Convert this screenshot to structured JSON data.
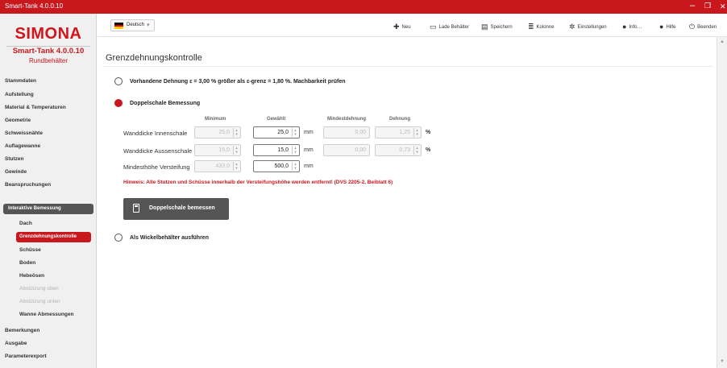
{
  "window": {
    "title": "Smart-Tank 4.0.0.10",
    "controls": {
      "minimize": "–",
      "restore": "❐",
      "close": "✕"
    }
  },
  "sidebar": {
    "logo": "SIMONA",
    "app_version": "Smart-Tank 4.0.0.10",
    "subtitle": "Rundbehälter",
    "items": [
      {
        "label": "Stammdaten"
      },
      {
        "label": "Aufstellung"
      },
      {
        "label": "Material & Temperaturen"
      },
      {
        "label": "Geometrie"
      },
      {
        "label": "Schweissnähte"
      },
      {
        "label": "Auflagewanne"
      },
      {
        "label": "Stutzen"
      },
      {
        "label": "Gewinde"
      },
      {
        "label": "Beanspruchungen"
      },
      {
        "label": "Interaktive Bemessung"
      },
      {
        "label": "Dach"
      },
      {
        "label": "Grenzdehnungskontrolle"
      },
      {
        "label": "Schüsse"
      },
      {
        "label": "Boden"
      },
      {
        "label": "Hebeösen"
      },
      {
        "label": "Abstützung oben"
      },
      {
        "label": "Abstützung unten"
      },
      {
        "label": "Wanne Abmessungen"
      },
      {
        "label": "Bemerkungen"
      },
      {
        "label": "Ausgabe"
      },
      {
        "label": "Parameterexport"
      }
    ]
  },
  "toolbar": {
    "language": "Deutsch",
    "buttons": [
      {
        "label": "Neu",
        "icon": "plus-icon"
      },
      {
        "label": "Lade Behälter",
        "icon": "folder-icon"
      },
      {
        "label": "Speichern",
        "icon": "save-icon"
      },
      {
        "label": "Kolonne",
        "icon": "column-icon"
      },
      {
        "label": "Einstellungen",
        "icon": "gear-icon"
      },
      {
        "label": "Info…",
        "icon": "info-icon"
      },
      {
        "label": "Hilfe",
        "icon": "help-icon"
      },
      {
        "label": "Beenden",
        "icon": "power-icon"
      }
    ]
  },
  "main": {
    "title": "Grenzdehnungskontrolle",
    "options": [
      {
        "label": "Vorhandene Dehnung ε = 3,00 % größer als ε-grenz = 1,80 %. Machbarkeit prüfen",
        "selected": false
      },
      {
        "label": "Doppelschale Bemessung",
        "selected": true
      },
      {
        "label": "Als Wickelbehälter ausführen",
        "selected": false
      }
    ],
    "table": {
      "headers": [
        "Minimum",
        "Gewählt",
        "Mindestdehnung",
        "Dehnung"
      ],
      "rows": [
        {
          "label": "Wanddicke Innenschale",
          "minimum": "25,0",
          "gewaehlt": "25,0",
          "unit": "mm",
          "mindestdehnung": "0,00",
          "dehnung": "1,25",
          "dehnung_unit": "%"
        },
        {
          "label": "Wanddicke Aussenschale",
          "minimum": "15,0",
          "gewaehlt": "15,0",
          "unit": "mm",
          "mindestdehnung": "0,00",
          "dehnung": "0,73",
          "dehnung_unit": "%"
        },
        {
          "label": "Mindesthöhe Versteifung",
          "minimum": "433,0",
          "gewaehlt": "500,0",
          "unit": "mm"
        }
      ]
    },
    "warning": "Hinweis: Alle Stutzen und Schüsse innerhalb der Versteifungshöhe werden entfernt! (DVS 2205-2, Beiblatt 6)",
    "action_button": "Doppelschale bemessen"
  },
  "colors": {
    "brand_red": "#c8181e",
    "dark_grey": "#555555"
  }
}
